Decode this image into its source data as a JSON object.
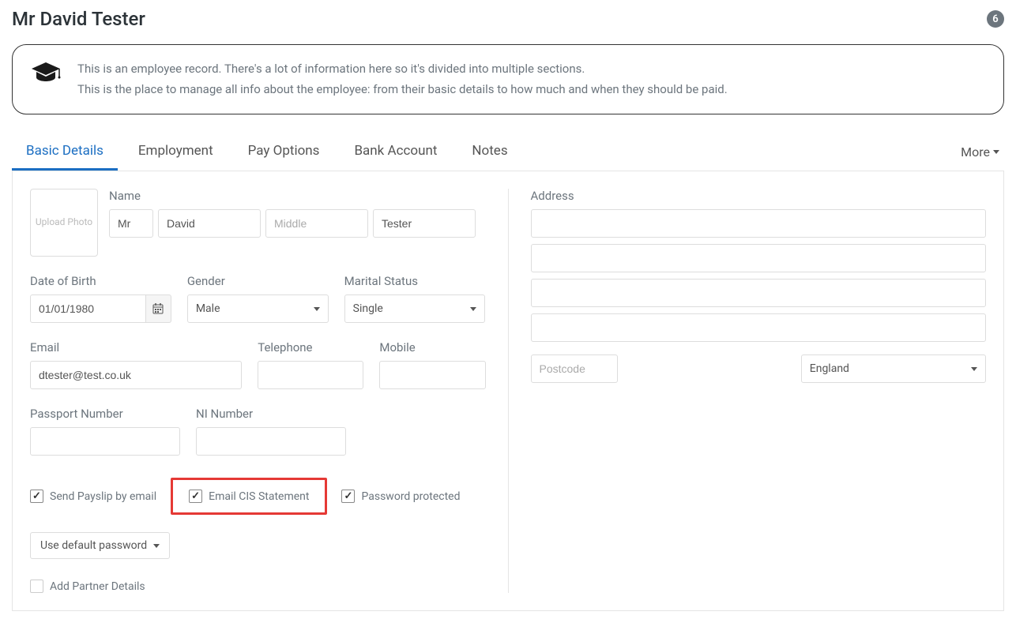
{
  "header": {
    "title": "Mr David Tester",
    "badge_count": "6"
  },
  "info": {
    "line1": "This is an employee record. There's a lot of information here so it's divided into multiple sections.",
    "line2": "This is the place to manage all info about the employee: from their basic details to how much and when they should be paid."
  },
  "tabs": {
    "basic": "Basic Details",
    "employment": "Employment",
    "pay": "Pay Options",
    "bank": "Bank Account",
    "notes": "Notes",
    "more": "More"
  },
  "basic_details": {
    "upload_photo": "Upload Photo",
    "name_label": "Name",
    "name": {
      "title": "Mr",
      "first": "David",
      "middle_placeholder": "Middle",
      "last": "Tester"
    },
    "dob_label": "Date of Birth",
    "dob": "01/01/1980",
    "gender_label": "Gender",
    "gender": "Male",
    "marital_label": "Marital Status",
    "marital": "Single",
    "email_label": "Email",
    "email": "dtester@test.co.uk",
    "telephone_label": "Telephone",
    "telephone": "",
    "mobile_label": "Mobile",
    "mobile": "",
    "passport_label": "Passport Number",
    "passport": "",
    "ni_label": "NI Number",
    "ni": "",
    "checkboxes": {
      "payslip_email": "Send Payslip by email",
      "email_cis": "Email CIS Statement",
      "password_protected": "Password protected"
    },
    "default_password": "Use default password",
    "add_partner": "Add Partner Details"
  },
  "address": {
    "label": "Address",
    "line1": "",
    "line2": "",
    "line3": "",
    "line4": "",
    "postcode_placeholder": "Postcode",
    "country": "England"
  }
}
